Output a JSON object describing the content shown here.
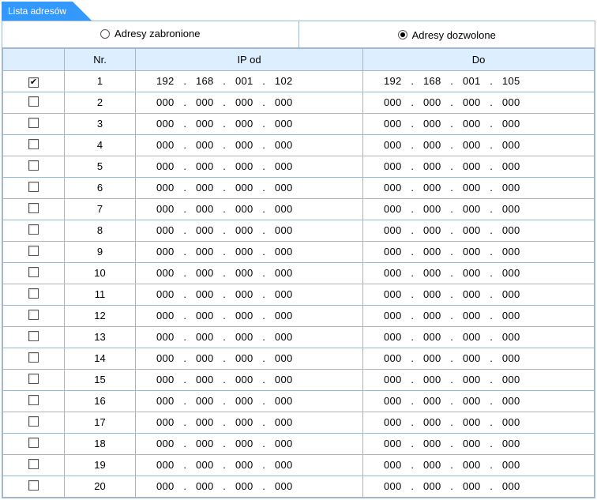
{
  "tab_title": "Lista adresów",
  "radios": {
    "forbidden_label": "Adresy zabronione",
    "allowed_label": "Adresy dozwolone",
    "selected": "allowed"
  },
  "headers": {
    "check": "",
    "nr": "Nr.",
    "ip_from": "IP od",
    "ip_to": "Do"
  },
  "rows": [
    {
      "checked": true,
      "nr": 1,
      "from": [
        "192",
        "168",
        "001",
        "102"
      ],
      "to": [
        "192",
        "168",
        "001",
        "105"
      ]
    },
    {
      "checked": false,
      "nr": 2,
      "from": [
        "000",
        "000",
        "000",
        "000"
      ],
      "to": [
        "000",
        "000",
        "000",
        "000"
      ]
    },
    {
      "checked": false,
      "nr": 3,
      "from": [
        "000",
        "000",
        "000",
        "000"
      ],
      "to": [
        "000",
        "000",
        "000",
        "000"
      ]
    },
    {
      "checked": false,
      "nr": 4,
      "from": [
        "000",
        "000",
        "000",
        "000"
      ],
      "to": [
        "000",
        "000",
        "000",
        "000"
      ]
    },
    {
      "checked": false,
      "nr": 5,
      "from": [
        "000",
        "000",
        "000",
        "000"
      ],
      "to": [
        "000",
        "000",
        "000",
        "000"
      ]
    },
    {
      "checked": false,
      "nr": 6,
      "from": [
        "000",
        "000",
        "000",
        "000"
      ],
      "to": [
        "000",
        "000",
        "000",
        "000"
      ]
    },
    {
      "checked": false,
      "nr": 7,
      "from": [
        "000",
        "000",
        "000",
        "000"
      ],
      "to": [
        "000",
        "000",
        "000",
        "000"
      ]
    },
    {
      "checked": false,
      "nr": 8,
      "from": [
        "000",
        "000",
        "000",
        "000"
      ],
      "to": [
        "000",
        "000",
        "000",
        "000"
      ]
    },
    {
      "checked": false,
      "nr": 9,
      "from": [
        "000",
        "000",
        "000",
        "000"
      ],
      "to": [
        "000",
        "000",
        "000",
        "000"
      ]
    },
    {
      "checked": false,
      "nr": 10,
      "from": [
        "000",
        "000",
        "000",
        "000"
      ],
      "to": [
        "000",
        "000",
        "000",
        "000"
      ]
    },
    {
      "checked": false,
      "nr": 11,
      "from": [
        "000",
        "000",
        "000",
        "000"
      ],
      "to": [
        "000",
        "000",
        "000",
        "000"
      ]
    },
    {
      "checked": false,
      "nr": 12,
      "from": [
        "000",
        "000",
        "000",
        "000"
      ],
      "to": [
        "000",
        "000",
        "000",
        "000"
      ]
    },
    {
      "checked": false,
      "nr": 13,
      "from": [
        "000",
        "000",
        "000",
        "000"
      ],
      "to": [
        "000",
        "000",
        "000",
        "000"
      ]
    },
    {
      "checked": false,
      "nr": 14,
      "from": [
        "000",
        "000",
        "000",
        "000"
      ],
      "to": [
        "000",
        "000",
        "000",
        "000"
      ]
    },
    {
      "checked": false,
      "nr": 15,
      "from": [
        "000",
        "000",
        "000",
        "000"
      ],
      "to": [
        "000",
        "000",
        "000",
        "000"
      ]
    },
    {
      "checked": false,
      "nr": 16,
      "from": [
        "000",
        "000",
        "000",
        "000"
      ],
      "to": [
        "000",
        "000",
        "000",
        "000"
      ]
    },
    {
      "checked": false,
      "nr": 17,
      "from": [
        "000",
        "000",
        "000",
        "000"
      ],
      "to": [
        "000",
        "000",
        "000",
        "000"
      ]
    },
    {
      "checked": false,
      "nr": 18,
      "from": [
        "000",
        "000",
        "000",
        "000"
      ],
      "to": [
        "000",
        "000",
        "000",
        "000"
      ]
    },
    {
      "checked": false,
      "nr": 19,
      "from": [
        "000",
        "000",
        "000",
        "000"
      ],
      "to": [
        "000",
        "000",
        "000",
        "000"
      ]
    },
    {
      "checked": false,
      "nr": 20,
      "from": [
        "000",
        "000",
        "000",
        "000"
      ],
      "to": [
        "000",
        "000",
        "000",
        "000"
      ]
    }
  ]
}
